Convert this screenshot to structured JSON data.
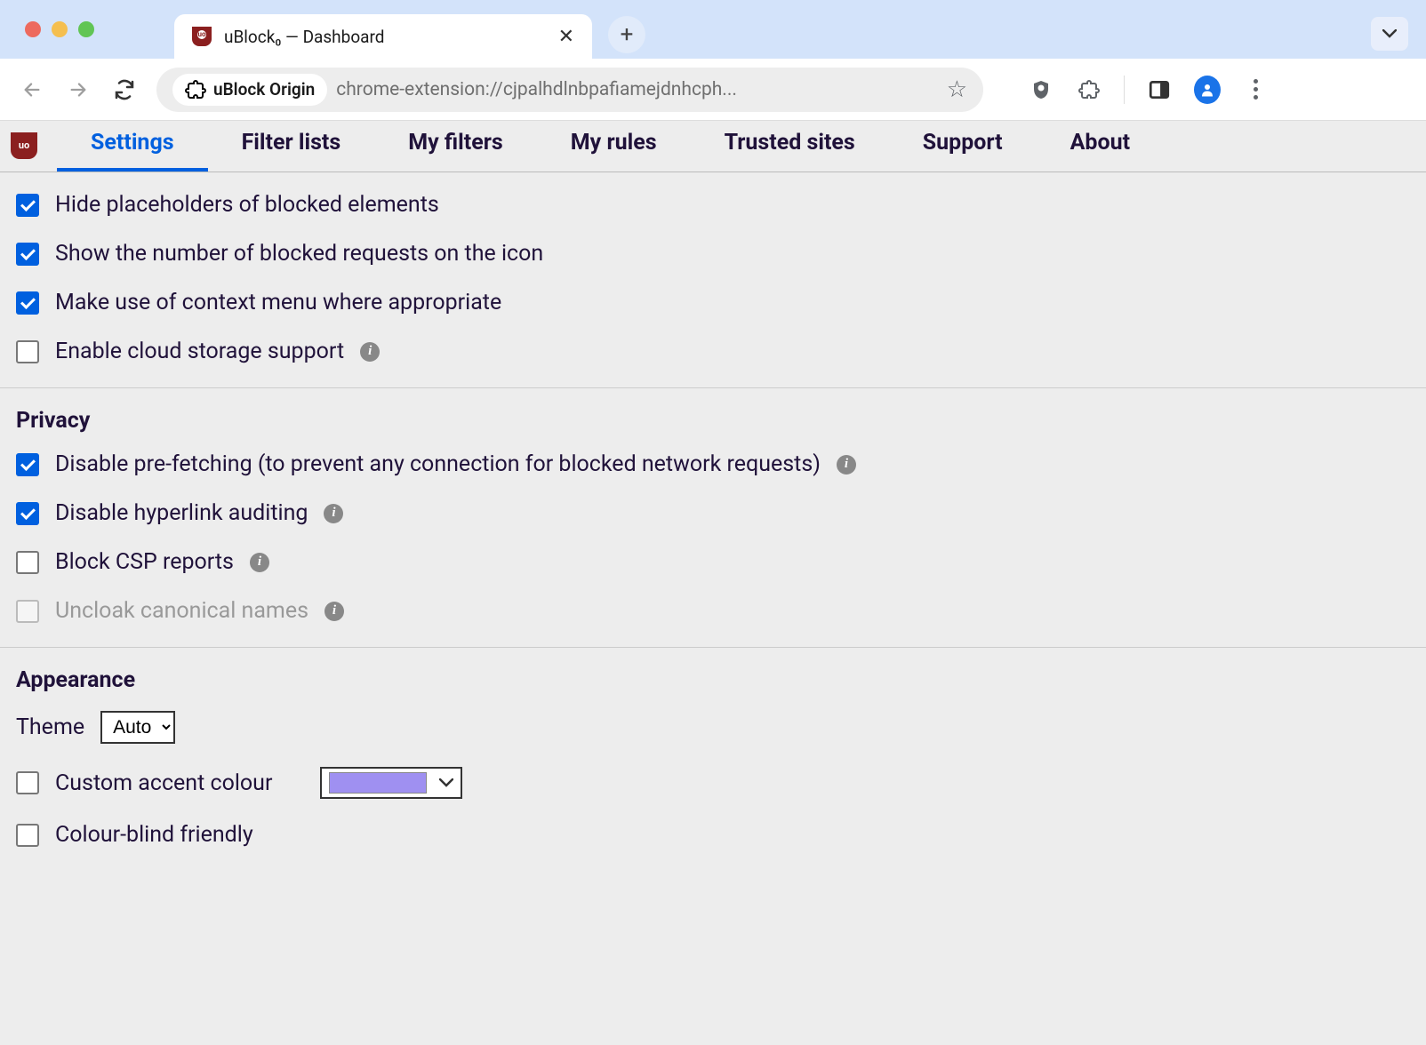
{
  "browser": {
    "tab_title": "uBlock₀ — Dashboard",
    "extension_name": "uBlock Origin",
    "url": "chrome-extension://cjpalhdlnbpafiamejdnhcph..."
  },
  "nav": {
    "tabs": [
      {
        "label": "Settings",
        "active": true
      },
      {
        "label": "Filter lists",
        "active": false
      },
      {
        "label": "My filters",
        "active": false
      },
      {
        "label": "My rules",
        "active": false
      },
      {
        "label": "Trusted sites",
        "active": false
      },
      {
        "label": "Support",
        "active": false
      },
      {
        "label": "About",
        "active": false
      }
    ]
  },
  "general_settings": [
    {
      "label": "Hide placeholders of blocked elements",
      "checked": true,
      "info": false,
      "disabled": false
    },
    {
      "label": "Show the number of blocked requests on the icon",
      "checked": true,
      "info": false,
      "disabled": false
    },
    {
      "label": "Make use of context menu where appropriate",
      "checked": true,
      "info": false,
      "disabled": false
    },
    {
      "label": "Enable cloud storage support",
      "checked": false,
      "info": true,
      "disabled": false
    }
  ],
  "privacy": {
    "title": "Privacy",
    "settings": [
      {
        "label": "Disable pre-fetching (to prevent any connection for blocked network requests)",
        "checked": true,
        "info": true,
        "disabled": false
      },
      {
        "label": "Disable hyperlink auditing",
        "checked": true,
        "info": true,
        "disabled": false
      },
      {
        "label": "Block CSP reports",
        "checked": false,
        "info": true,
        "disabled": false
      },
      {
        "label": "Uncloak canonical names",
        "checked": false,
        "info": true,
        "disabled": true
      }
    ]
  },
  "appearance": {
    "title": "Appearance",
    "theme_label": "Theme",
    "theme_value": "Auto",
    "custom_accent": {
      "label": "Custom accent colour",
      "checked": false,
      "color": "#9f90f1"
    },
    "colorblind": {
      "label": "Colour-blind friendly",
      "checked": false
    }
  }
}
